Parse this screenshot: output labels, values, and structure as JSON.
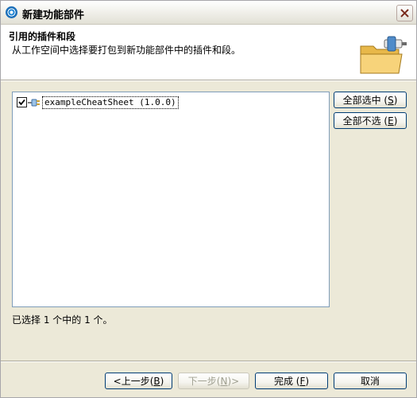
{
  "window": {
    "title": "新建功能部件"
  },
  "banner": {
    "title": "引用的插件和段",
    "description": "从工作空间中选择要打包到新功能部件中的插件和段。"
  },
  "tree": {
    "items": [
      {
        "label": "exampleCheatSheet (1.0.0)",
        "checked": true
      }
    ]
  },
  "side_buttons": {
    "select_all": {
      "text": "全部选中",
      "mnemonic": "S"
    },
    "deselect_all": {
      "text": "全部不选",
      "mnemonic": "E"
    }
  },
  "status": "已选择 1 个中的 1 个。",
  "footer": {
    "back": {
      "text": "<上一步",
      "mnemonic": "B"
    },
    "next": {
      "text": "下一步",
      "mnemonic": "N",
      "suffix": ">"
    },
    "finish": {
      "text": "完成",
      "mnemonic": "F"
    },
    "cancel": {
      "text": "取消"
    }
  },
  "colors": {
    "accent_border": "#003C74",
    "list_border": "#7F9DB9",
    "dialog_bg": "#ECE9D8"
  }
}
